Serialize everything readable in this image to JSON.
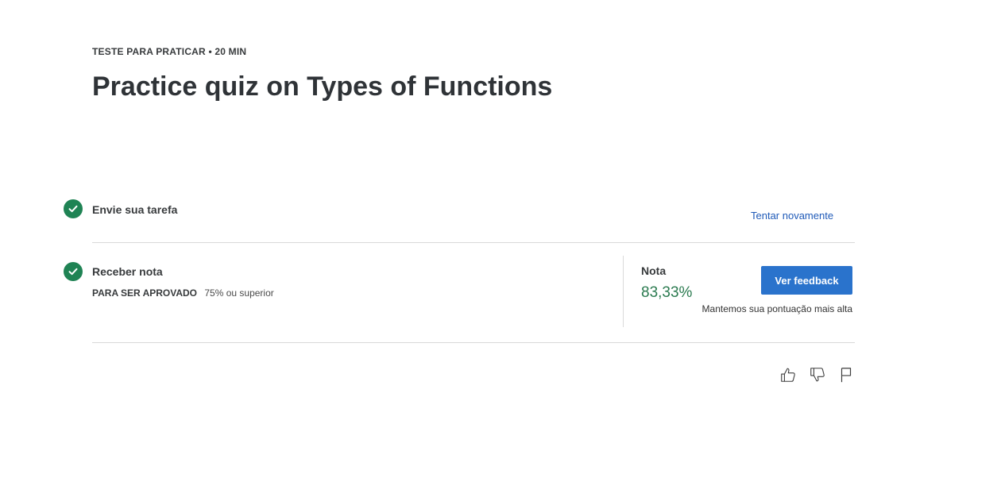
{
  "header": {
    "eyebrow": "TESTE PARA PRATICAR • 20 MIN",
    "title": "Practice quiz on Types of Functions"
  },
  "steps": {
    "submit": {
      "label": "Envie sua tarefa",
      "status_icon": "check-circle-icon",
      "retry_label": "Tentar novamente"
    },
    "grade": {
      "label": "Receber nota",
      "status_icon": "check-circle-icon",
      "pass_key": "PARA SER APROVADO",
      "pass_value": "75% ou superior",
      "grade_label": "Nota",
      "grade_value": "83,33%",
      "feedback_button": "Ver feedback",
      "note": "Mantemos sua pontuação mais alta"
    }
  },
  "footer_actions": [
    "like-icon",
    "dislike-icon",
    "flag-icon"
  ],
  "colors": {
    "success": "#1f8354",
    "grade_text": "#2a7a4f",
    "primary": "#2a73cc",
    "link": "#1f5ab8"
  }
}
